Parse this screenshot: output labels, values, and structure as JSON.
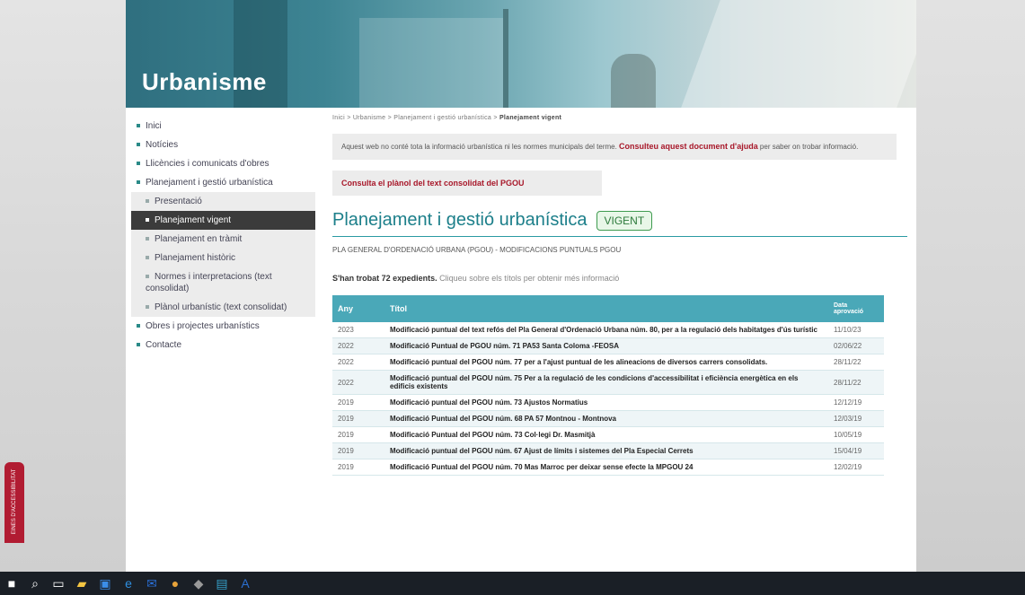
{
  "banner": {
    "title": "Urbanisme"
  },
  "sidebar": {
    "items": [
      {
        "label": "Inici",
        "level": 0,
        "state": "normal"
      },
      {
        "label": "Notícies",
        "level": 0,
        "state": "normal"
      },
      {
        "label": "Llicències i comunicats d'obres",
        "level": 0,
        "state": "normal"
      },
      {
        "label": "Planejament i gestió urbanística",
        "level": 0,
        "state": "normal"
      },
      {
        "label": "Presentació",
        "level": 1,
        "state": "normal"
      },
      {
        "label": "Planejament vigent",
        "level": 1,
        "state": "active"
      },
      {
        "label": "Planejament en tràmit",
        "level": 1,
        "state": "normal"
      },
      {
        "label": "Planejament històric",
        "level": 1,
        "state": "normal"
      },
      {
        "label": "Normes i interpretacions (text consolidat)",
        "level": 1,
        "state": "normal"
      },
      {
        "label": "Plànol urbanístic (text consolidat)",
        "level": 1,
        "state": "hl"
      },
      {
        "label": "Obres i projectes urbanístics",
        "level": 0,
        "state": "normal"
      },
      {
        "label": "Contacte",
        "level": 0,
        "state": "normal"
      }
    ]
  },
  "main": {
    "breadcrumb": {
      "trail": "Inici > Urbanisme > Planejament i gestió urbanística > ",
      "current": "Planejament vigent"
    },
    "notice": {
      "text": "Aquest web no conté tota la informació urbanística ni les normes municipals del terme. ",
      "link": "Consulteu aquest document d'ajuda",
      "text2": " per saber on trobar informació."
    },
    "consult_link": "Consulta el plànol del text consolidat del PGOU",
    "heading": "Planejament i gestió urbanística",
    "badge": "VIGENT",
    "subtitle": "PLA GENERAL D'ORDENACIÓ URBANA (PGOU) - MODIFICACIONS PUNTUALS PGOU",
    "count_bold": "S'han trobat 72 expedients.",
    "count_hint": " Cliqueu sobre els títols per obtenir més informació",
    "table": {
      "headers": {
        "year": "Any",
        "title": "Títol",
        "date": "Data aprovació"
      },
      "rows": [
        {
          "year": "2023",
          "title": "Modificació puntual del text refós del Pla General d'Ordenació Urbana núm. 80, per a la regulació dels habitatges d'ús turístic",
          "date": "11/10/23"
        },
        {
          "year": "2022",
          "title": "Modificació Puntual de PGOU núm. 71 PA53 Santa Coloma -FEOSA",
          "date": "02/06/22"
        },
        {
          "year": "2022",
          "title": "Modificació puntual del PGOU núm. 77 per a l'ajust puntual de les alineacions de diversos carrers consolidats.",
          "date": "28/11/22"
        },
        {
          "year": "2022",
          "title": "Modificació puntual del PGOU núm. 75 Per a la regulació de les condicions d'accessibilitat i eficiència energètica en els edificis existents",
          "date": "28/11/22"
        },
        {
          "year": "2019",
          "title": "Modificació puntual del PGOU núm. 73 Ajustos Normatius",
          "date": "12/12/19"
        },
        {
          "year": "2019",
          "title": "Modificació Puntual del PGOU núm. 68 PA 57 Montnou - Montnova",
          "date": "12/03/19"
        },
        {
          "year": "2019",
          "title": "Modificació Puntual del PGOU núm. 73 Col·legi Dr. Masmitjà",
          "date": "10/05/19"
        },
        {
          "year": "2019",
          "title": "Modificació puntual del PGOU núm. 67 Ajust de límits i sistemes del Pla Especial Cerrets",
          "date": "15/04/19"
        },
        {
          "year": "2019",
          "title": "Modificació Puntual del PGOU núm. 70 Mas Marroc per deixar sense efecte la MPGOU 24",
          "date": "12/02/19"
        }
      ]
    }
  },
  "accessibility_tab": {
    "label": "EINES D'ACCESSIBILITAT"
  },
  "taskbar": {
    "icons": [
      "windows-start-icon",
      "search-icon",
      "task-view-icon",
      "file-explorer-icon",
      "store-icon",
      "edge-icon",
      "mail-icon",
      "chrome-icon",
      "app-icon",
      "app-icon-2",
      "app-icon-3"
    ]
  }
}
